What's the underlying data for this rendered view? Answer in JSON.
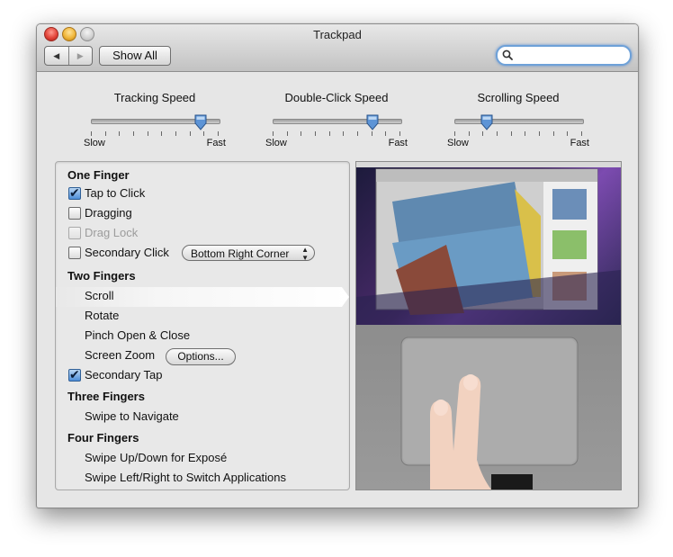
{
  "window": {
    "title": "Trackpad",
    "show_all_label": "Show All",
    "search": {
      "placeholder": "",
      "value": ""
    }
  },
  "sliders": [
    {
      "label": "Tracking Speed",
      "min_label": "Slow",
      "max_label": "Fast",
      "value_fraction": 0.86
    },
    {
      "label": "Double-Click Speed",
      "min_label": "Slow",
      "max_label": "Fast",
      "value_fraction": 0.78
    },
    {
      "label": "Scrolling Speed",
      "min_label": "Slow",
      "max_label": "Fast",
      "value_fraction": 0.25
    }
  ],
  "one_finger": {
    "heading": "One Finger",
    "tap_to_click": {
      "label": "Tap to Click",
      "checked": true
    },
    "dragging": {
      "label": "Dragging",
      "checked": false
    },
    "drag_lock": {
      "label": "Drag Lock",
      "checked": false,
      "disabled": true
    },
    "secondary_click": {
      "label": "Secondary Click",
      "checked": false,
      "option": "Bottom Right Corner"
    }
  },
  "two_fingers": {
    "heading": "Two Fingers",
    "scroll": "Scroll",
    "rotate": "Rotate",
    "pinch": "Pinch Open & Close",
    "screen_zoom": "Screen Zoom",
    "options_label": "Options...",
    "secondary_tap": {
      "label": "Secondary Tap",
      "checked": true
    }
  },
  "three_fingers": {
    "heading": "Three Fingers",
    "swipe_navigate": "Swipe to Navigate"
  },
  "four_fingers": {
    "heading": "Four Fingers",
    "swipe_expose": "Swipe Up/Down for Exposé",
    "swipe_switch": "Swipe Left/Right to Switch Applications"
  },
  "colors": {
    "accent": "#4e8ed9",
    "selection": "#ffffff"
  }
}
